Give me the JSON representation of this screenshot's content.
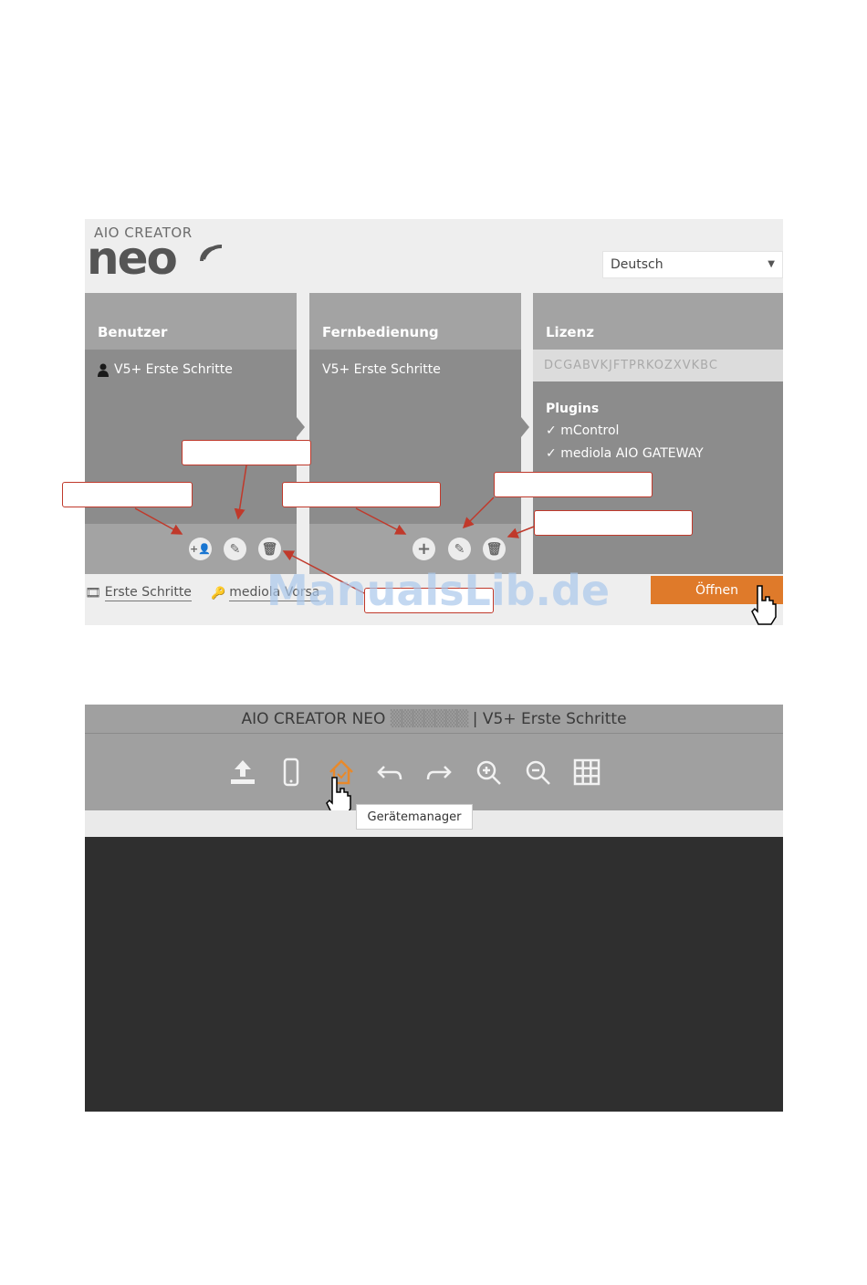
{
  "shot1": {
    "logo": {
      "top": "AIO CREATOR",
      "main": "neo"
    },
    "language": {
      "value": "Deutsch"
    },
    "columns": {
      "benutzer": {
        "title": "Benutzer",
        "items": [
          "V5+ Erste Schritte"
        ]
      },
      "fernbedienung": {
        "title": "Fernbedienung",
        "items": [
          "V5+ Erste Schritte"
        ]
      },
      "lizenz": {
        "title": "Lizenz",
        "key": "DCGABVKJFTPRKOZXVKBC",
        "plugins_title": "Plugins",
        "plugins": [
          "mControl",
          "mediola AIO GATEWAY"
        ]
      }
    },
    "links": {
      "erste_schritte": "Erste Schritte",
      "mediola": "mediola Vorsa"
    },
    "open_button": "Öffnen",
    "watermark": "ManualsLib.de"
  },
  "shot2": {
    "title": "AIO CREATOR NEO",
    "title_version": "| V5+ Erste Schritte",
    "tooltip": "Gerätemanager",
    "tools": [
      "upload-icon",
      "phone-icon",
      "home-icon",
      "undo-icon",
      "redo-icon",
      "zoom-in-icon",
      "zoom-out-icon",
      "grid-icon"
    ],
    "accent": "#e8892b"
  }
}
